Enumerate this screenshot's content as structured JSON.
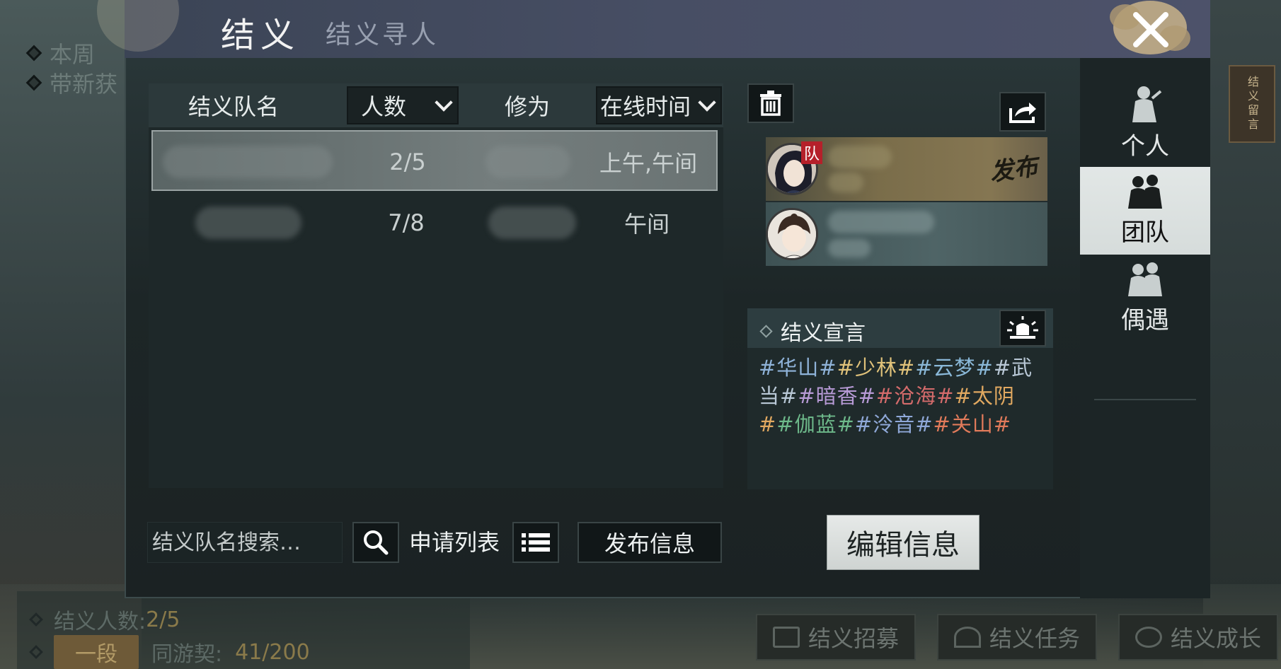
{
  "background": {
    "left_items": [
      "本周",
      "带新获"
    ],
    "scroll_plaque": "结义留言",
    "bottom_info": {
      "member_count_label": "结义人数:",
      "member_count_value": "2/5",
      "rank_badge": "一段",
      "bond_label": "同游契:",
      "bond_value": "41/200"
    },
    "bottom_buttons": [
      {
        "label": "结义招募",
        "icon": "recruit-icon"
      },
      {
        "label": "结义任务",
        "icon": "task-icon"
      },
      {
        "label": "结义成长",
        "icon": "growth-icon"
      }
    ]
  },
  "header": {
    "title": "结义",
    "subtitle": "结义寻人",
    "close_icon": "close-icon"
  },
  "table": {
    "col_name": "结义队名",
    "col_count": "人数",
    "col_cultivation": "修为",
    "col_online": "在线时间",
    "rows": [
      {
        "name": "",
        "count": "2/5",
        "cultivation": "",
        "online": "上午,午间",
        "selected": true
      },
      {
        "name": "",
        "count": "7/8",
        "cultivation": "",
        "online": "午间",
        "selected": false
      }
    ]
  },
  "search": {
    "placeholder": "结义队名搜索…",
    "search_icon": "search-icon",
    "apply_label": "申请列表",
    "list_icon": "list-icon",
    "publish_label": "发布信息"
  },
  "team_panel": {
    "delete_icon": "trash-icon",
    "share_icon": "share-icon",
    "leader_tag": "队",
    "publish_stamp": "发布",
    "declaration_title": "结义宣言",
    "broadcast_icon": "broadcast-icon",
    "tags": [
      {
        "text": "华山",
        "color": "#8fb3d9"
      },
      {
        "text": "少林",
        "color": "#e0c27a"
      },
      {
        "text": "云梦",
        "color": "#8ab8d8"
      },
      {
        "text": "武当",
        "color": "#b9c8d6"
      },
      {
        "text": "暗香",
        "color": "#b79ad6"
      },
      {
        "text": "沧海",
        "color": "#d46b6b"
      },
      {
        "text": "太阴",
        "color": "#e0a860"
      },
      {
        "text": "伽蓝",
        "color": "#6db88a"
      },
      {
        "text": "泠音",
        "color": "#8fa8d8"
      },
      {
        "text": "关山",
        "color": "#e07a5a"
      }
    ],
    "edit_label": "编辑信息"
  },
  "side_tabs": [
    {
      "label": "个人",
      "icon": "person-icon",
      "active": false
    },
    {
      "label": "团队",
      "icon": "team-icon",
      "active": true
    },
    {
      "label": "偶遇",
      "icon": "encounter-icon",
      "active": false
    }
  ]
}
